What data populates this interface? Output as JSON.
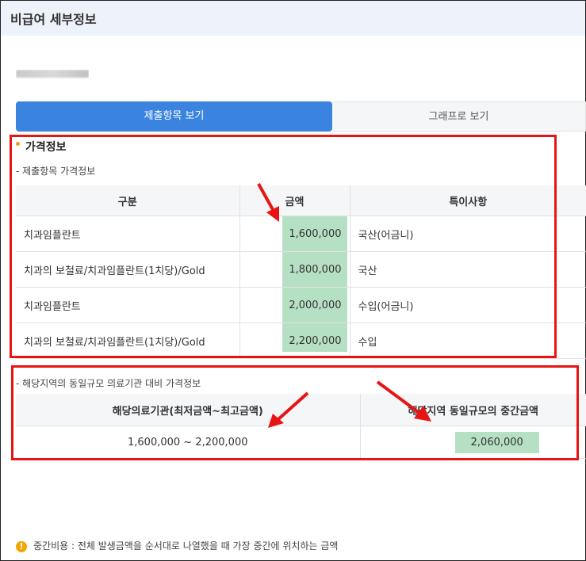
{
  "header": {
    "title": "비급여 세부정보"
  },
  "tabs": [
    {
      "label": "제출항목 보기",
      "active": true
    },
    {
      "label": "그래프로 보기",
      "active": false
    }
  ],
  "section": {
    "title": "가격정보"
  },
  "price_table": {
    "subtitle": "- 제출항목 가격정보",
    "headers": [
      "구분",
      "금액",
      "특이사항"
    ],
    "rows": [
      {
        "category": "치과임플란트",
        "amount": "1,600,000",
        "note": "국산(어금니)"
      },
      {
        "category": "치과의 보철료/치과임플란트(1치당)/Gold",
        "amount": "1,800,000",
        "note": "국산"
      },
      {
        "category": "치과임플란트",
        "amount": "2,000,000",
        "note": "수입(어금니)"
      },
      {
        "category": "치과의 보철료/치과임플란트(1치당)/Gold",
        "amount": "2,200,000",
        "note": "수입"
      }
    ]
  },
  "compare_table": {
    "subtitle": "- 해당지역의 동일규모 의료기관 대비 가격정보",
    "headers": [
      "해당의료기관(최저금액~최고금액)",
      "해당지역 동일규모의 중간금액"
    ],
    "range": "1,600,000 ~ 2,200,000",
    "median": "2,060,000"
  },
  "footer": {
    "icon": "!",
    "text": "중간비용 : 전체 발생금액을 순서대로 나열했을 때 가장 중간에 위치하는 금액"
  },
  "colors": {
    "accent": "#3a84e0",
    "highlight": "#b6e0c4",
    "annotation": "#e81414"
  }
}
